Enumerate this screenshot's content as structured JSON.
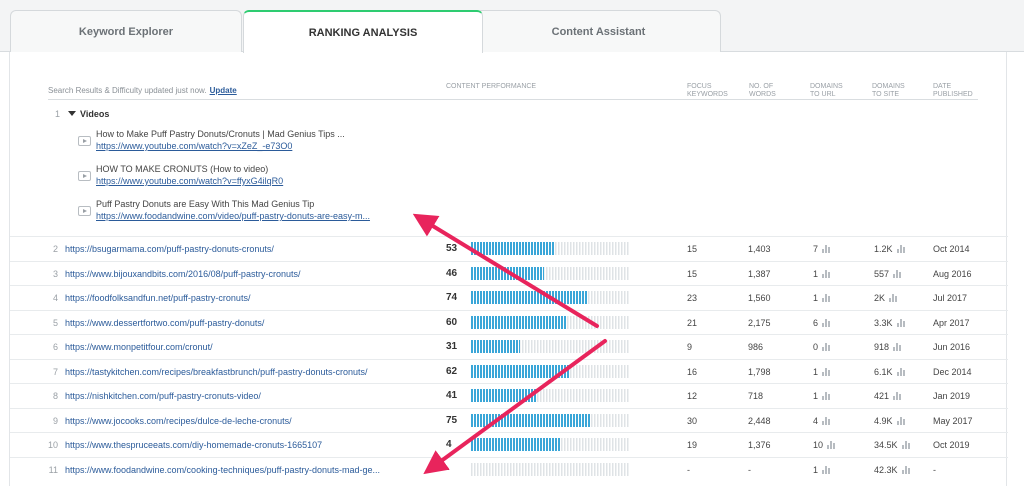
{
  "tabs": [
    {
      "label": "Keyword Explorer",
      "active": false
    },
    {
      "label": "RANKING ANALYSIS",
      "active": true
    },
    {
      "label": "Content Assistant",
      "active": false
    }
  ],
  "status": {
    "text": "Search Results & Difficulty updated just now.",
    "link": "Update"
  },
  "columns": {
    "content_performance": "CONTENT PERFORMANCE",
    "focus_keywords": [
      "FOCUS",
      "KEYWORDS"
    ],
    "no_of_words": [
      "NO. OF",
      "WORDS"
    ],
    "domains_to_url": [
      "DOMAINS",
      "TO URL"
    ],
    "domains_to_site": [
      "DOMAINS",
      "TO SITE"
    ],
    "date_published": [
      "DATE",
      "PUBLISHED"
    ]
  },
  "videos": {
    "num": "1",
    "title": "Videos",
    "items": [
      {
        "title": "How to Make Puff Pastry Donuts/Cronuts | Mad Genius Tips ...",
        "url": "https://www.youtube.com/watch?v=xZeZ_-e73O0"
      },
      {
        "title": "HOW TO MAKE CRONUTS (How to video)",
        "url": "https://www.youtube.com/watch?v=ffyxG4ilqR0"
      },
      {
        "title": "Puff Pastry Donuts are Easy With This Mad Genius Tip",
        "url": "https://www.foodandwine.com/video/puff-pastry-donuts-are-easy-m..."
      }
    ]
  },
  "rows": [
    {
      "num": "2",
      "url": "https://bsugarmama.com/puff-pastry-donuts-cronuts/",
      "score": "53",
      "perf": 0.53,
      "focus": "15",
      "words": "1,403",
      "durl": "7",
      "dsite": "1.2K",
      "date": "Oct 2014"
    },
    {
      "num": "3",
      "url": "https://www.bijouxandbits.com/2016/08/puff-pastry-cronuts/",
      "score": "46",
      "perf": 0.46,
      "focus": "15",
      "words": "1,387",
      "durl": "1",
      "dsite": "557",
      "date": "Aug 2016"
    },
    {
      "num": "4",
      "url": "https://foodfolksandfun.net/puff-pastry-cronuts/",
      "score": "74",
      "perf": 0.74,
      "focus": "23",
      "words": "1,560",
      "durl": "1",
      "dsite": "2K",
      "date": "Jul 2017"
    },
    {
      "num": "5",
      "url": "https://www.dessertfortwo.com/puff-pastry-donuts/",
      "score": "60",
      "perf": 0.6,
      "focus": "21",
      "words": "2,175",
      "durl": "6",
      "dsite": "3.3K",
      "date": "Apr 2017"
    },
    {
      "num": "6",
      "url": "https://www.monpetitfour.com/cronut/",
      "score": "31",
      "perf": 0.31,
      "focus": "9",
      "words": "986",
      "durl": "0",
      "dsite": "918",
      "date": "Jun 2016"
    },
    {
      "num": "7",
      "url": "https://tastykitchen.com/recipes/breakfastbrunch/puff-pastry-donuts-cronuts/",
      "score": "62",
      "perf": 0.62,
      "focus": "16",
      "words": "1,798",
      "durl": "1",
      "dsite": "6.1K",
      "date": "Dec 2014"
    },
    {
      "num": "8",
      "url": "https://nishkitchen.com/puff-pastry-cronuts-video/",
      "score": "41",
      "perf": 0.41,
      "focus": "12",
      "words": "718",
      "durl": "1",
      "dsite": "421",
      "date": "Jan 2019"
    },
    {
      "num": "9",
      "url": "https://www.jocooks.com/recipes/dulce-de-leche-cronuts/",
      "score": "75",
      "perf": 0.75,
      "focus": "30",
      "words": "2,448",
      "durl": "4",
      "dsite": "4.9K",
      "date": "May 2017"
    },
    {
      "num": "10",
      "url": "https://www.thespruceeats.com/diy-homemade-cronuts-1665107",
      "score": "4",
      "perf": 0.57,
      "focus": "19",
      "words": "1,376",
      "durl": "10",
      "dsite": "34.5K",
      "date": "Oct 2019"
    },
    {
      "num": "11",
      "url": "https://www.foodandwine.com/cooking-techniques/puff-pastry-donuts-mad-ge...",
      "score": "-",
      "perf": 0,
      "focus": "-",
      "words": "-",
      "durl": "1",
      "dsite": "42.3K",
      "date": "-"
    }
  ],
  "colors": {
    "accent": "#2ecc71",
    "bar": "#3aa6d8",
    "link": "#2b5b9a",
    "arrow": "#e8245c"
  }
}
